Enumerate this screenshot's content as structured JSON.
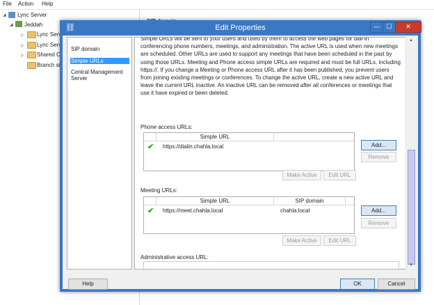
{
  "menu": {
    "file": "File",
    "action": "Action",
    "help": "Help"
  },
  "tree": {
    "root": "Lync Server",
    "site": "Jeddah",
    "items": [
      "Lync Serv",
      "Lync Serv",
      "Shared Co",
      "Branch sit"
    ]
  },
  "right_pane": {
    "header": "SIP domain"
  },
  "dialog": {
    "title": "Edit Properties",
    "window_buttons": {
      "minimize": "—",
      "maximize": "☐",
      "close": "✕"
    },
    "nav": [
      "SIP domain",
      "Simple URLs",
      "Central Management Server"
    ],
    "nav_selected": "Simple URLs",
    "description": "Simple URLs will be sent to your users and used by them to access the web pages for dial-in conferencing phone numbers, meetings, and administration. The active URL is used when new meetings are scheduled. Other URLs are used to support any meetings that have been scheduled in the past by using those URLs. Meeting and Phone access simple URLs are required and must be full URLs, including https://. If you change a Meeting or Phone access URL after it has been published, you prevent users from joining existing meetings or conferences. To change the active URL, create a new active URL and leave the current URL inactive. An inactive URL can be removed after all conferences or meetings that use it have expired or been deleted.",
    "phone": {
      "label": "Phone access URLs:",
      "columns": [
        "Simple URL"
      ],
      "rows": [
        {
          "active": true,
          "url": "https://dialin.chahla.local"
        }
      ],
      "add": "Add...",
      "remove": "Remove",
      "make_active": "Make Active",
      "edit_url": "Edit URL"
    },
    "meeting": {
      "label": "Meeting URLs:",
      "columns": [
        "Simple URL",
        "SIP domain"
      ],
      "rows": [
        {
          "active": true,
          "url": "https://meet.chahla.local",
          "domain": "chahla.local"
        }
      ],
      "add": "Add...",
      "remove": "Remove",
      "make_active": "Make Active",
      "edit_url": "Edit URL"
    },
    "admin": {
      "label": "Administrative access URL:",
      "value": ""
    },
    "footer": {
      "help": "Help",
      "ok": "OK",
      "cancel": "Cancel"
    }
  },
  "colors": {
    "title_bar": "#3b78c4",
    "selection": "#3399ff",
    "check": "#2fa72f",
    "close_button": "#c73b2e"
  }
}
